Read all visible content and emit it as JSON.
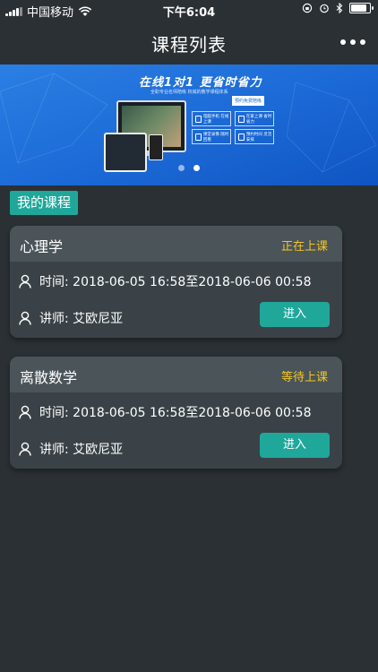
{
  "status_bar": {
    "carrier": "中国移动",
    "time": "下午6:04",
    "battery_level": 0.85
  },
  "nav": {
    "title": "课程列表",
    "more_icon": "more-dots-icon"
  },
  "banner": {
    "headline": "在线1对1 更省时省力",
    "subline": "全职专业名师陪练  权威的教学课程体系",
    "badge": "预约免费陪练",
    "features": [
      "电脑手机 在线上课",
      "在家上课 省时省力",
      "课堂录像 随时回看",
      "预约时间 灵活安排"
    ],
    "carousel": {
      "count": 2,
      "active_index": 1
    }
  },
  "section": {
    "label": "我的课程"
  },
  "courses": [
    {
      "name": "心理学",
      "status": "正在上课",
      "time_label": "时间: 2018-06-05 16:58至2018-06-06 00:58",
      "teacher_label": "讲师: 艾欧尼亚",
      "enter_label": "进入"
    },
    {
      "name": "离散数学",
      "status": "等待上课",
      "time_label": "时间: 2018-06-05 16:58至2018-06-06 00:58",
      "teacher_label": "讲师: 艾欧尼亚",
      "enter_label": "进入"
    }
  ],
  "colors": {
    "background": "#2b3034",
    "accent": "#1fa79a",
    "status_text": "#f3c623",
    "banner_blue": "#1b69d6"
  }
}
